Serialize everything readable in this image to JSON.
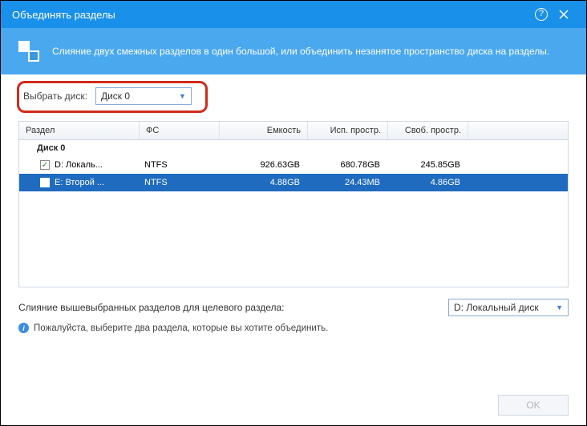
{
  "titlebar": {
    "title": "Объединять разделы"
  },
  "banner": {
    "text": "Слияние двух смежных разделов в один большой, или объединить незанятое пространство диска на разделы."
  },
  "disk_select": {
    "label": "Выбрать диск:",
    "value": "Диск 0"
  },
  "table": {
    "headers": {
      "partition": "Раздел",
      "fs": "ФС",
      "capacity": "Емкость",
      "used": "Исп. простр.",
      "free": "Своб. простр."
    },
    "group": "Диск 0",
    "rows": [
      {
        "checked": true,
        "selected": false,
        "name": "D:  Локаль...",
        "fs": "NTFS",
        "capacity": "926.63GB",
        "used": "680.78GB",
        "free": "245.85GB"
      },
      {
        "checked": false,
        "selected": true,
        "name": "E:  Второй ...",
        "fs": "NTFS",
        "capacity": "4.88GB",
        "used": "24.43MB",
        "free": "4.86GB"
      }
    ]
  },
  "footer": {
    "target_label": "Слияние вышевыбранных разделов для целевого раздела:",
    "target_value": "D:  Локальный диск",
    "hint": "Пожалуйста, выберите два раздела, которые вы хотите объединить."
  },
  "buttons": {
    "ok": "OK"
  }
}
